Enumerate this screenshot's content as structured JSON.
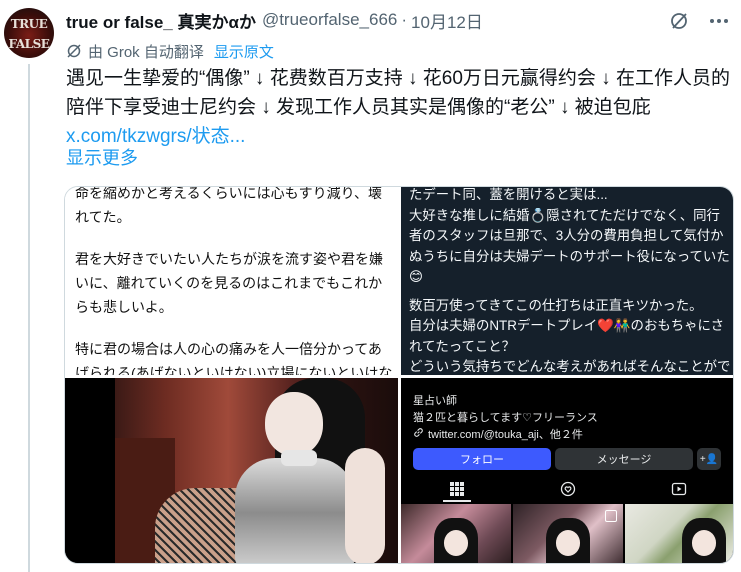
{
  "tweet": {
    "author_name": "true or false_ 真実かαか",
    "handle": "@trueorfalse_666",
    "separator": "·",
    "date": "10月12日",
    "avatar_text_line1": "TRUE",
    "avatar_text_line2": "FALSE",
    "translate_label": "由 Grok 自动翻译",
    "show_original": "显示原文",
    "text": "遇见一生挚爱的“偶像” ↓ 花费数百万支持 ↓ 花60万日元赢得约会 ↓ 在工作人员的陪伴下享受迪士尼约会 ↓ 发现工作人员其实是偶像的“老公” ↓ 被迫包庇",
    "link_text": "x.com/tkzwgrs/状态...",
    "show_more": "显示更多"
  },
  "icons": {
    "grok": "grok-slash-icon",
    "more": "more-dots-icon",
    "translate": "translate-icon"
  },
  "media": {
    "panel1": {
      "paragraphs": [
        "命を縮めかと考えるくらいには心もすり減り、壊れてた。",
        "君を大好きでいたい人たちが涙を流す姿や君を嫌いに、離れていくのを見るのはこれまでもこれからも悲しいよ。",
        "特に君の場合は人の心の痛みを人一倍分かってあげられる(あげないといけない)立場にないといけないはずじゃないの"
      ]
    },
    "panel2": {
      "paragraphs": [
        "たデート同、蓋を開けると実は...\n大好きな推しに結婚💍隠されてただけでなく、同行者のスタッフは旦那で、3人分の費用負担して気付かぬうちに自分は夫婦デートのサポート役になっていた😊",
        "数百万使ってきてこの仕打ちは正直キツかった。\n自分は夫婦のNTRデートプレイ❤️👫のおもちゃにされてたってこと？\nどういう気持ちでどんな考えがあればそんなことができるのか教えて欲しい。"
      ]
    },
    "panel4": {
      "name": "星占い師",
      "bio": "猫２匹と暮らしてます♡フリーランス",
      "link": "twitter.com/@touka_aji、他２件",
      "follow_label": "フォロー",
      "message_label": "メッセージ",
      "add_label": "+👤"
    }
  },
  "colors": {
    "accent": "#1d9bf0",
    "follow_button": "#3d5afe"
  }
}
